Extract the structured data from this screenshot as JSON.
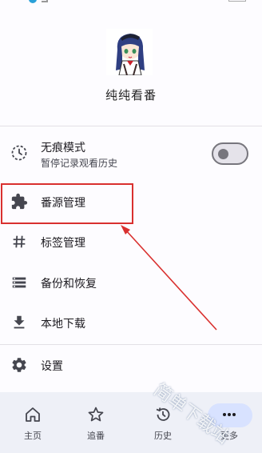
{
  "header": {
    "app_name": "纯纯看番"
  },
  "incognito": {
    "title": "无痕模式",
    "subtitle": "暂停记录观看历史",
    "enabled": false
  },
  "menu": {
    "source_manage": "番源管理",
    "tag_manage": "标签管理",
    "backup_restore": "备份和恢复",
    "local_download": "本地下载",
    "settings": "设置"
  },
  "bottom_nav": {
    "home": "主页",
    "follow": "追番",
    "history": "历史",
    "more": "更多",
    "selected": "more"
  },
  "watermark": "简单下载站",
  "colors": {
    "accent": "#d9302f",
    "nav_bg": "#eef0f7",
    "nav_pill": "#d8e2ff"
  }
}
